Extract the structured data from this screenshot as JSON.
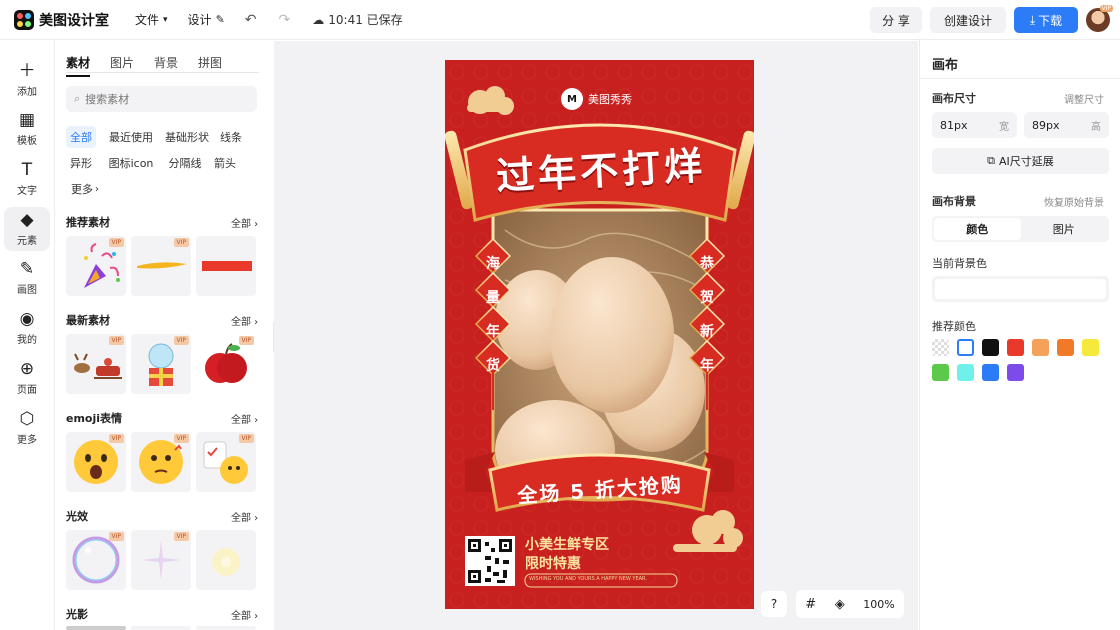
{
  "app": {
    "name": "美图设计室"
  },
  "toolbar": {
    "menu_file": "文件",
    "menu_design": "设计",
    "saved_status": "10:41 已保存",
    "share": "分 享",
    "create": "创建设计",
    "download": "下载",
    "avatar_badge": "VIP"
  },
  "rail": [
    {
      "label": "添加",
      "icon": "＋"
    },
    {
      "label": "模板",
      "icon": "▦"
    },
    {
      "label": "文字",
      "icon": "T"
    },
    {
      "label": "元素",
      "icon": "◆"
    },
    {
      "label": "画图",
      "icon": "✎"
    },
    {
      "label": "我的",
      "icon": "◉"
    },
    {
      "label": "页面",
      "icon": "⊕"
    },
    {
      "label": "更多",
      "icon": "⬡"
    }
  ],
  "panel": {
    "tabs": [
      "素材",
      "图片",
      "背景",
      "拼图"
    ],
    "search_placeholder": "搜索素材",
    "chips": [
      "全部",
      "最近使用",
      "基础形状",
      "线条",
      "异形",
      "图标icon",
      "分隔线",
      "箭头",
      "更多"
    ],
    "all_label": "全部",
    "vip": "VIP",
    "sections": [
      "推荐素材",
      "最新素材",
      "emoji表情",
      "光效",
      "光影"
    ]
  },
  "poster": {
    "brand": "美图秀秀",
    "headline": "过年不打烊",
    "left_tags": [
      "海",
      "量",
      "年",
      "货"
    ],
    "right_tags": [
      "恭",
      "贺",
      "新",
      "年"
    ],
    "ribbon": "全场 5 折大抢购",
    "footer_line1": "小美生鲜专区",
    "footer_line2": "限时特惠",
    "footer_small": "WISHING YOU AND YOURS A HAPPY NEW YEAR."
  },
  "canvas_tools": {
    "help": "?",
    "zoom": "100%"
  },
  "right_panel": {
    "title": "画布",
    "size_label": "画布尺寸",
    "size_link": "调整尺寸",
    "width_value": "81px",
    "width_unit": "宽",
    "height_value": "89px",
    "height_unit": "高",
    "ai_button": "AI尺寸延展",
    "bg_label": "画布背景",
    "bg_link": "恢复原始背景",
    "seg_color": "颜色",
    "seg_image": "图片",
    "current_bg_label": "当前背景色",
    "recommended_label": "推荐颜色",
    "swatches": [
      "transparent",
      "#ffffff",
      "#111111",
      "#e8392a",
      "#f4a259",
      "#f07a28",
      "#f5ea3b",
      "#5cc94a",
      "#6ff0ea",
      "#2b7cf6",
      "#7c4bea"
    ]
  }
}
